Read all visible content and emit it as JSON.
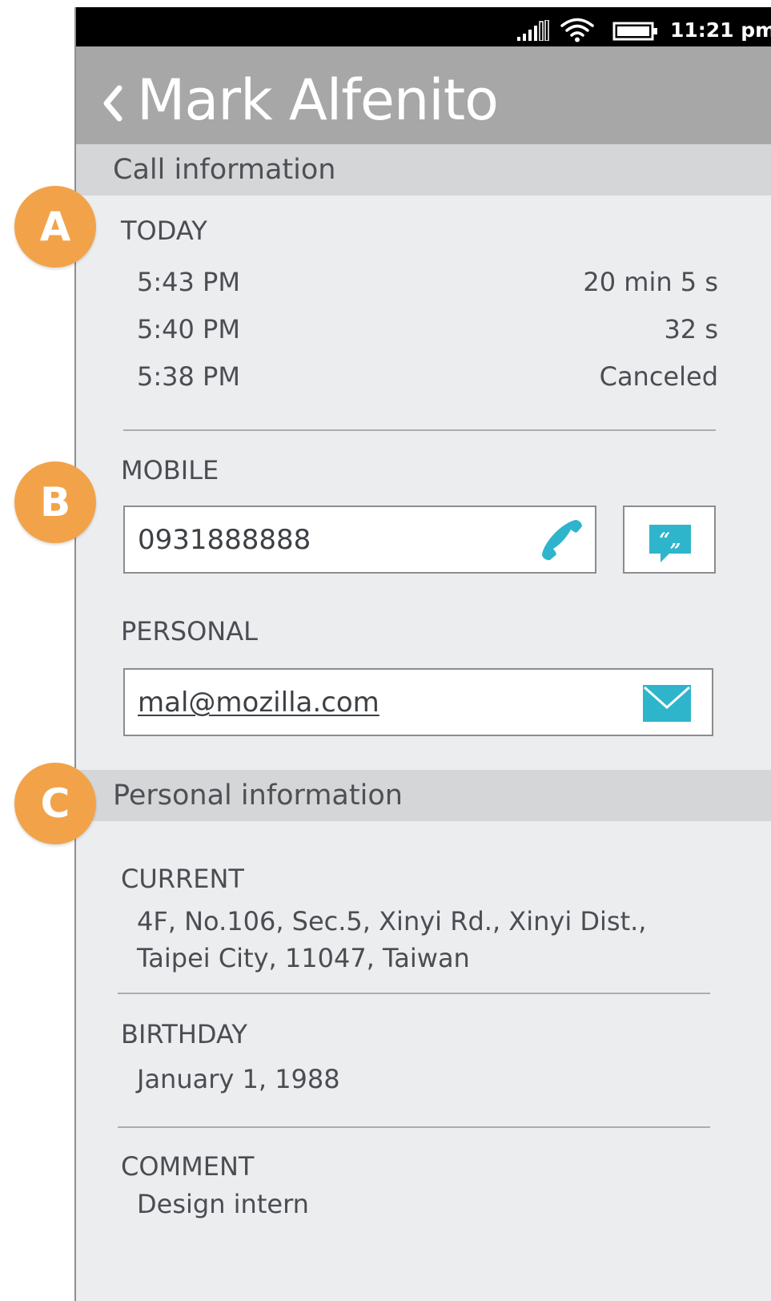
{
  "status_bar": {
    "time": "11:21 pm",
    "icons": [
      "signal-icon",
      "wifi-icon",
      "battery-icon"
    ]
  },
  "header": {
    "back_icon": "chevron-left-icon",
    "title": "Mark Alfenito"
  },
  "call_information": {
    "section_title": "Call information",
    "day_label": "TODAY",
    "calls": [
      {
        "time": "5:43 PM",
        "duration": "20 min 5 s"
      },
      {
        "time": "5:40 PM",
        "duration": "32 s"
      },
      {
        "time": "5:38 PM",
        "duration": "Canceled"
      }
    ]
  },
  "contact": {
    "mobile_label": "MOBILE",
    "mobile_number": "0931888888",
    "mobile_icons": [
      "phone-icon",
      "sms-icon"
    ],
    "personal_label": "PERSONAL",
    "email": "mal@mozilla.com",
    "email_icon": "mail-icon"
  },
  "personal_information": {
    "section_title": "Personal information",
    "current_label": "CURRENT",
    "address_line1": "4F, No.106, Sec.5, Xinyi Rd., Xinyi Dist.,",
    "address_line2": "Taipei City, 11047, Taiwan",
    "birthday_label": "BIRTHDAY",
    "birthday": "January 1, 1988",
    "comment_label": "COMMENT",
    "comment": "Design intern"
  },
  "callouts": {
    "a": "A",
    "b": "B",
    "c": "C"
  },
  "colors": {
    "accent": "#2fb5cb",
    "badge": "#f2a34a",
    "header": "#a7a7a7",
    "section_bar": "#d5d6d8",
    "background": "#ecedef"
  }
}
